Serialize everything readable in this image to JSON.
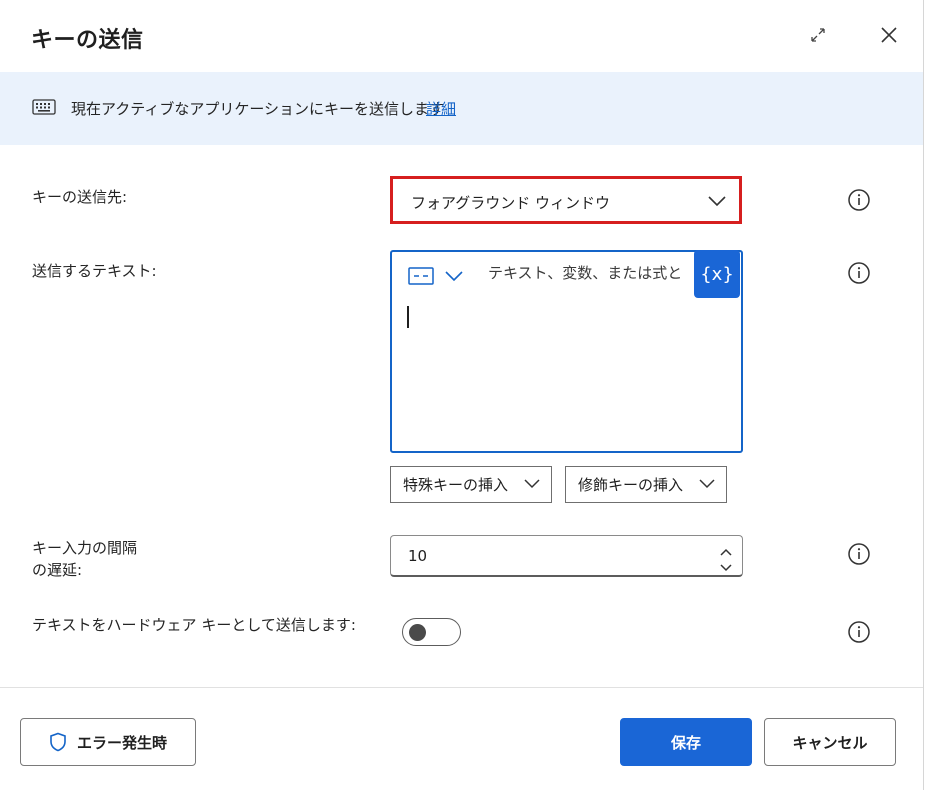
{
  "dialog": {
    "title": "キーの送信",
    "expand_icon": "expand-icon",
    "close_icon": "close-icon"
  },
  "banner": {
    "icon": "keyboard-icon",
    "text": "現在アクティブなアプリケーションにキーを送信します",
    "link": "詳細"
  },
  "fields": {
    "target": {
      "label": "キーの送信先:",
      "value": "フォアグラウンド ウィンドウ"
    },
    "text": {
      "label": "送信するテキスト:",
      "placeholder": "テキスト、変数、または式と",
      "value": "",
      "variable_button": "{x}"
    },
    "insert_special_key": "特殊キーの挿入",
    "insert_modifier_key": "修飾キーの挿入",
    "delay": {
      "label_line1": "キー入力の間隔",
      "label_line2": "の遅延:",
      "value": "10"
    },
    "hardware": {
      "label": "テキストをハードウェア キーとして送信します:",
      "enabled": false
    }
  },
  "footer": {
    "on_error": "エラー発生時",
    "save": "保存",
    "cancel": "キャンセル"
  },
  "colors": {
    "accent": "#1a66d6",
    "highlight_border": "#d61f1f",
    "banner_bg": "#eaf2fc"
  }
}
